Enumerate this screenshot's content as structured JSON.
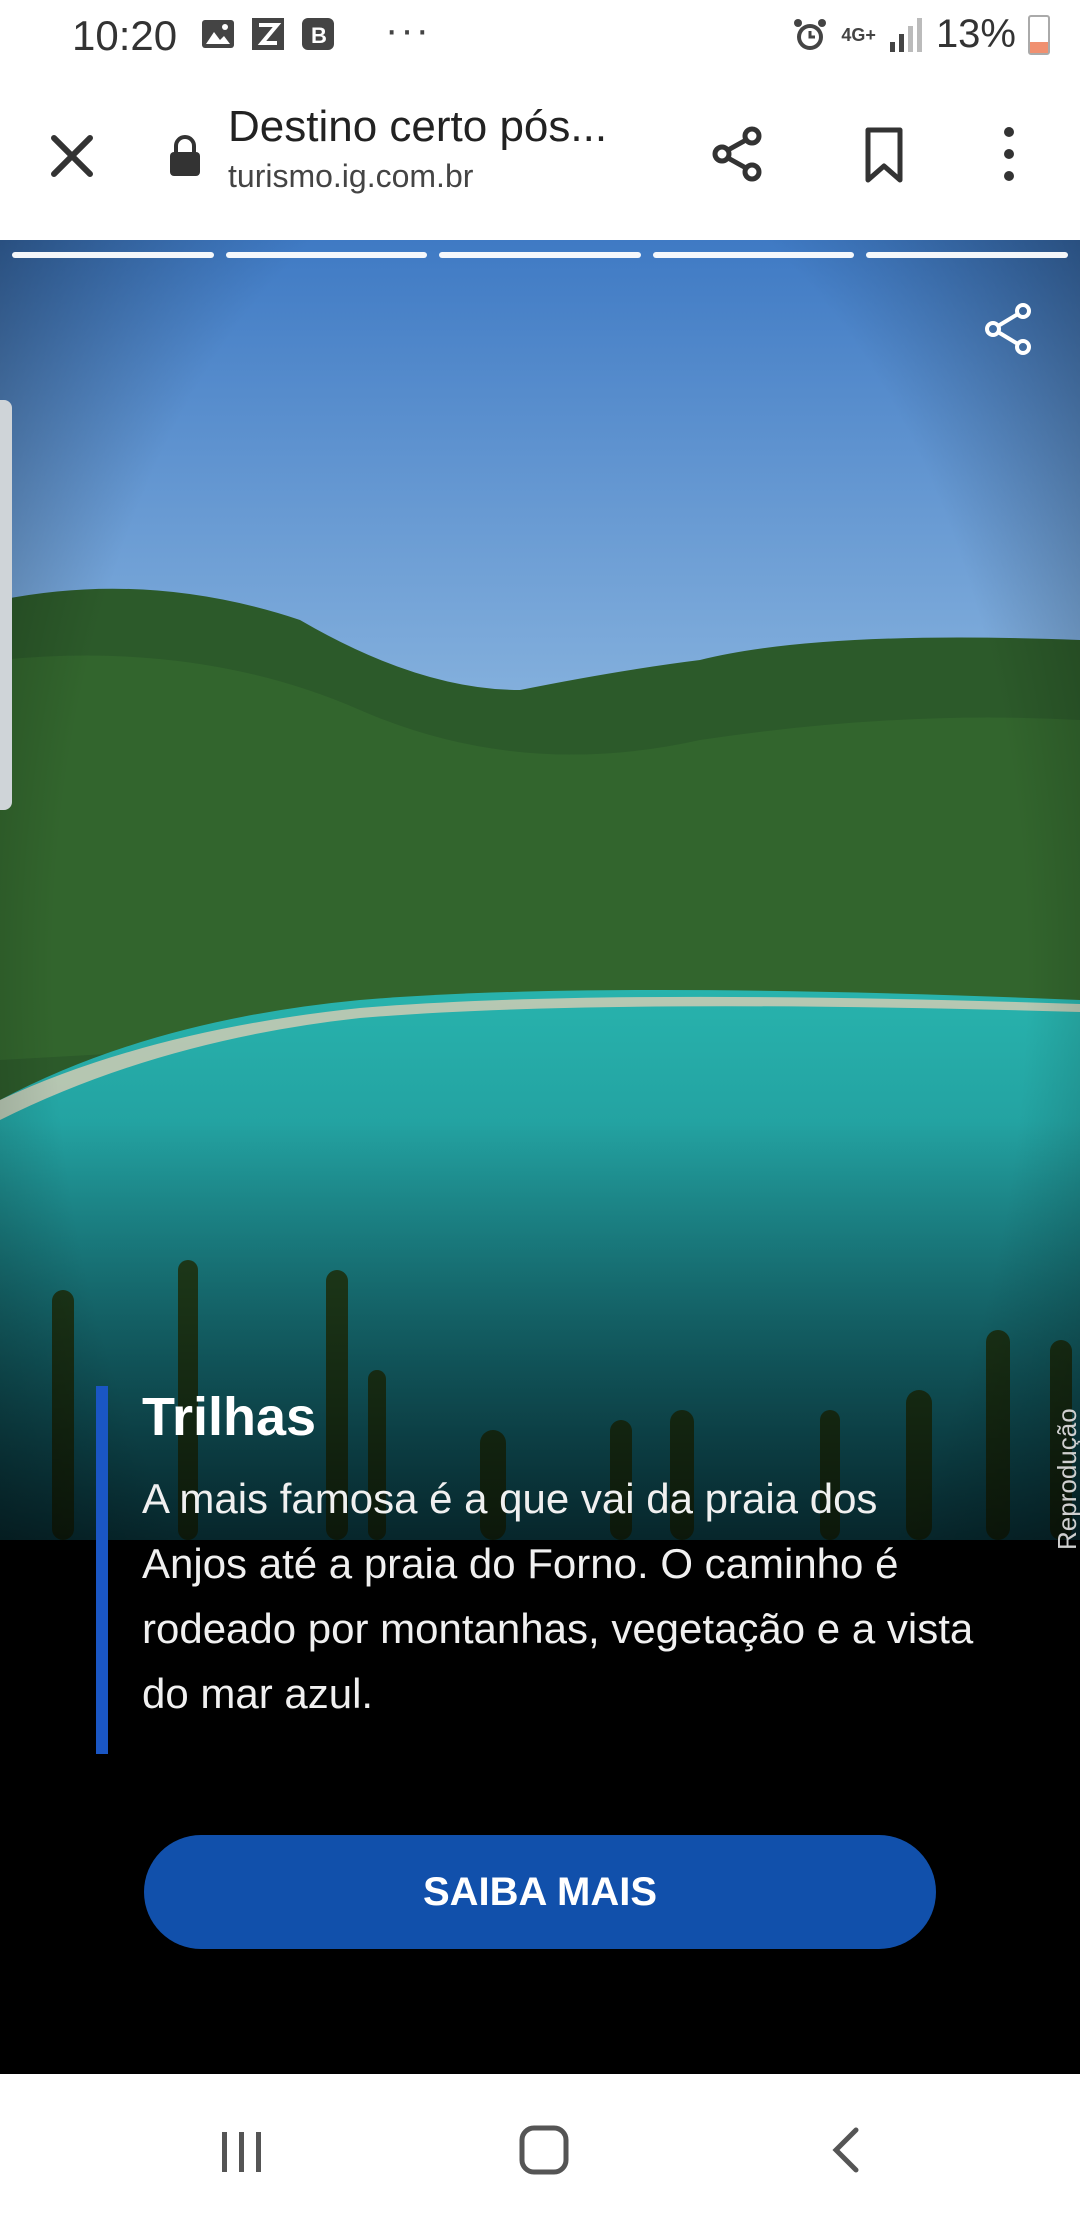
{
  "status_bar": {
    "time": "10:20",
    "more": "···",
    "network": "4G+",
    "battery": "13%"
  },
  "toolbar": {
    "title": "Destino certo pós...",
    "url": "turismo.ig.com.br"
  },
  "story": {
    "progress_segments": 5,
    "title": "Trilhas",
    "body": "A mais famosa é a que vai da praia dos Anjos até a praia do Forno. O caminho é rodeado por montanhas, vegetação e a vista do mar azul.",
    "credit": "Reprodução",
    "cta_label": "SAIBA MAIS"
  },
  "colors": {
    "accent_blue": "#1a56c4",
    "cta_blue": "#1150ab",
    "sky": "#4a86c8",
    "sea": "#1f9aa0",
    "hill": "#2c5a2a"
  }
}
